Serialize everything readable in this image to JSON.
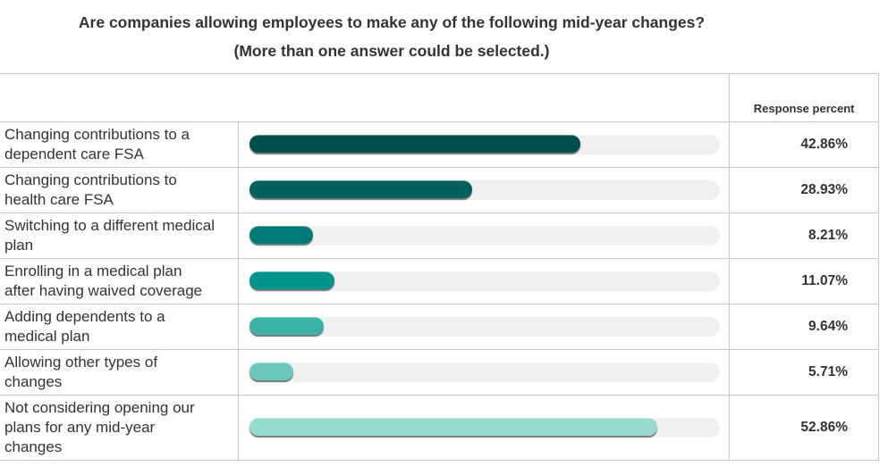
{
  "title_line1": "Are companies allowing employees to make any of the following mid-year changes?",
  "title_line2": "(More than one answer could be selected.)",
  "column_header": "Response percent",
  "rows": [
    {
      "label_lines": [
        "Changing contributions to a",
        "dependent care FSA"
      ],
      "value": 42.86,
      "display": "42.86%",
      "color": "#004d4b"
    },
    {
      "label_lines": [
        "Changing contributions to",
        "health care FSA"
      ],
      "value": 28.93,
      "display": "28.93%",
      "color": "#00605d"
    },
    {
      "label_lines": [
        "Switching to a different medical",
        "plan"
      ],
      "value": 8.21,
      "display": "8.21%",
      "color": "#007a76"
    },
    {
      "label_lines": [
        "Enrolling in a medical plan",
        "after having waived coverage"
      ],
      "value": 11.07,
      "display": "11.07%",
      "color": "#00938d"
    },
    {
      "label_lines": [
        "Adding dependents to a",
        "medical plan"
      ],
      "value": 9.64,
      "display": "9.64%",
      "color": "#3bb3a8"
    },
    {
      "label_lines": [
        "Allowing other types of",
        "changes"
      ],
      "value": 5.71,
      "display": "5.71%",
      "color": "#6cc8bd"
    },
    {
      "label_lines": [
        "Not considering opening our",
        "plans for any mid-year",
        "changes"
      ],
      "value": 52.86,
      "display": "52.86%",
      "color": "#99dbcf"
    }
  ],
  "chart_data": {
    "type": "bar",
    "orientation": "horizontal",
    "title": "Are companies allowing employees to make any of the following mid-year changes? (More than one answer could be selected.)",
    "categories": [
      "Changing contributions to a dependent care FSA",
      "Changing contributions to health care FSA",
      "Switching to a different medical plan",
      "Enrolling in a medical plan after having waived coverage",
      "Adding dependents to a medical plan",
      "Allowing other types of changes",
      "Not considering opening our plans for any mid-year changes"
    ],
    "values": [
      42.86,
      28.93,
      8.21,
      11.07,
      9.64,
      5.71,
      52.86
    ],
    "value_labels": [
      "42.86%",
      "28.93%",
      "8.21%",
      "11.07%",
      "9.64%",
      "5.71%",
      "52.86%"
    ],
    "xlabel": "",
    "ylabel": "",
    "value_column_header": "Response percent",
    "xlim": [
      0,
      61
    ],
    "grid": false,
    "legend": "none"
  }
}
